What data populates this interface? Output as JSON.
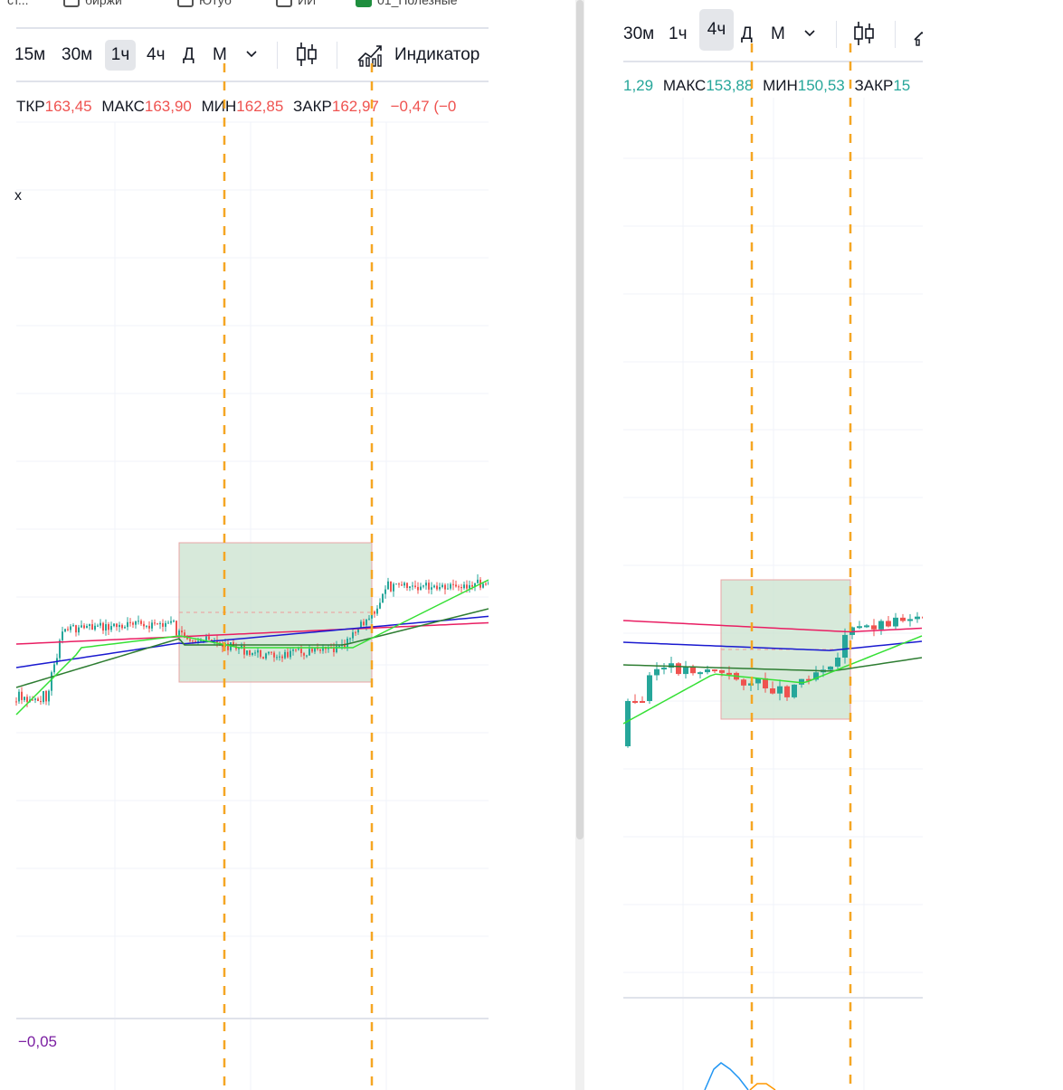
{
  "left": {
    "bookmarks": [
      {
        "label": "ст..."
      },
      {
        "label": "биржи"
      },
      {
        "label": "Ютуб"
      },
      {
        "label": "ИИ"
      },
      {
        "label": "01_Полезные"
      }
    ],
    "timeframes": [
      "15м",
      "30м",
      "1ч",
      "4ч",
      "Д",
      "М"
    ],
    "active_timeframe": "1ч",
    "indicators_label": "Индикатор",
    "ohlc": {
      "open_label": "ТКР",
      "open": "163,45",
      "high_label": "МАКС",
      "high": "163,90",
      "low_label": "МИН",
      "low": "162,85",
      "close_label": "ЗАКР",
      "close": "162,97",
      "change": "−0,47 (−0"
    },
    "close_glyph": "x",
    "indicator_value": "−0,05"
  },
  "right": {
    "timeframes": [
      "30м",
      "1ч",
      "4ч",
      "Д",
      "М"
    ],
    "active_timeframe": "4ч",
    "ohlc": {
      "open": "1,29",
      "high_label": "МАКС",
      "high": "153,88",
      "low_label": "МИН",
      "low": "150,53",
      "close_label": "ЗАКР",
      "close": "15"
    }
  },
  "colors": {
    "up": "#26a69a",
    "down": "#ef5350",
    "marker": "#f5a623",
    "zone": "#c9e2cd",
    "ema_fast": "#35e035",
    "ema_mid": "#2e7d32",
    "ema_blue": "#1a1ad0",
    "ema_pink": "#e91e63"
  },
  "icons": [
    "chevron-down-icon",
    "candles-icon",
    "indicators-icon",
    "checkbox-icon"
  ]
}
